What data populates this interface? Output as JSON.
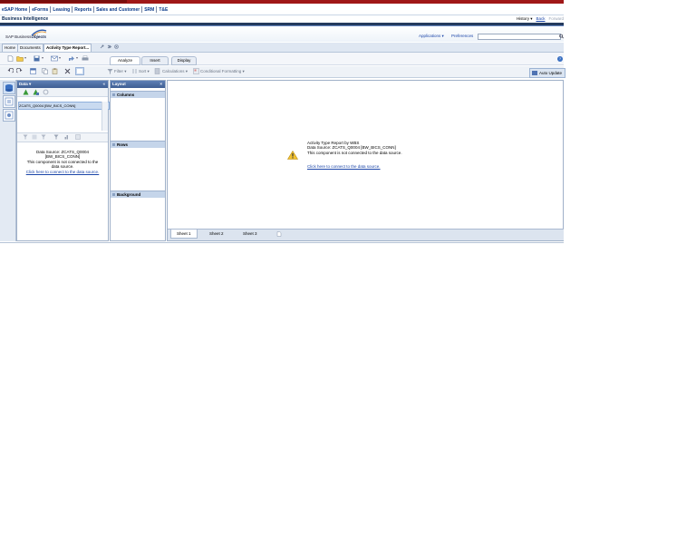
{
  "nav": {
    "items": [
      "eSAP Home",
      "eForms",
      "Leasing",
      "Reports",
      "Sales and Customer",
      "SRM",
      "T&E"
    ]
  },
  "header": {
    "title": "Business Intelligence",
    "history": "History",
    "back": "Back",
    "forward": "Forward"
  },
  "logo": {
    "text_prefix": "SAP Business",
    "text_brand": "Objects"
  },
  "topright": {
    "applications": "Applications",
    "preferences": "Preferences",
    "search_value": ""
  },
  "doc_tabs": {
    "home": "Home",
    "documents": "Documents",
    "active": "Activity Type Report..."
  },
  "ribbon_tabs": {
    "analyze": "Analyze",
    "insert": "Insert",
    "display": "Display"
  },
  "toolbar": {
    "filter": "Filter",
    "sort": "Sort",
    "calculations": "Calculations",
    "conditional_formatting": "Conditional Formatting",
    "auto_update": "Auto Update"
  },
  "data_panel": {
    "title": "Data",
    "source_item": "ZCATS_Q0004 [BW_BICS_CONN]",
    "msg_lines": [
      "Data Source: ZCATS_Q0004",
      "[BW_BICS_CONN]",
      "This component is not connected to the",
      "data source."
    ],
    "link": "Click here to connect to the data source."
  },
  "layout_panel": {
    "title": "Layout",
    "columns": "Columns",
    "rows": "Rows",
    "background": "Background"
  },
  "canvas": {
    "line1": "Activity Type Report by WBS",
    "line2": "Data Source: ZCATS_Q0004 [BW_BICS_CONN]",
    "line3": "This component is not connected to the data source.",
    "link": "Click here to connect to the data source."
  },
  "sheets": [
    "Sheet 1",
    "Sheet 2",
    "Sheet 3"
  ],
  "colors": {
    "accent_red": "#a01818",
    "header_navy": "#243a5e",
    "link_blue": "#1b45a8",
    "panel_header": "#4a6ba3"
  }
}
